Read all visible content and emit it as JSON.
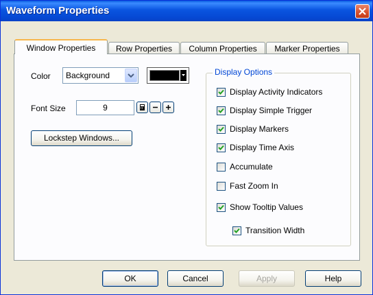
{
  "window": {
    "title": "Waveform Properties",
    "close_label": "close"
  },
  "tabs": [
    {
      "label": "Window Properties",
      "active": true
    },
    {
      "label": "Row Properties",
      "active": false
    },
    {
      "label": "Column Properties",
      "active": false
    },
    {
      "label": "Marker Properties",
      "active": false
    }
  ],
  "color": {
    "label": "Color",
    "selected": "Background",
    "swatch_color": "#000000"
  },
  "font_size": {
    "label": "Font Size",
    "value": "9"
  },
  "lockstep_button": "Lockstep Windows...",
  "display_options": {
    "title": "Display Options",
    "items": [
      {
        "label": "Display Activity Indicators",
        "checked": true
      },
      {
        "label": "Display Simple Trigger",
        "checked": true
      },
      {
        "label": "Display Markers",
        "checked": true
      },
      {
        "label": "Display Time Axis",
        "checked": true
      },
      {
        "label": "Accumulate",
        "checked": false
      },
      {
        "label": "Fast Zoom In",
        "checked": false
      },
      {
        "label": "Show Tooltip Values",
        "checked": true
      },
      {
        "label": "Transition Width",
        "checked": true
      }
    ]
  },
  "buttons": {
    "ok": "OK",
    "cancel": "Cancel",
    "apply": "Apply",
    "help": "Help"
  },
  "colors": {
    "titlebar": "#0a55e0",
    "dialog_bg": "#ece9d8",
    "group_title": "#0046d5",
    "active_tab_accent": "#f8b64b"
  }
}
